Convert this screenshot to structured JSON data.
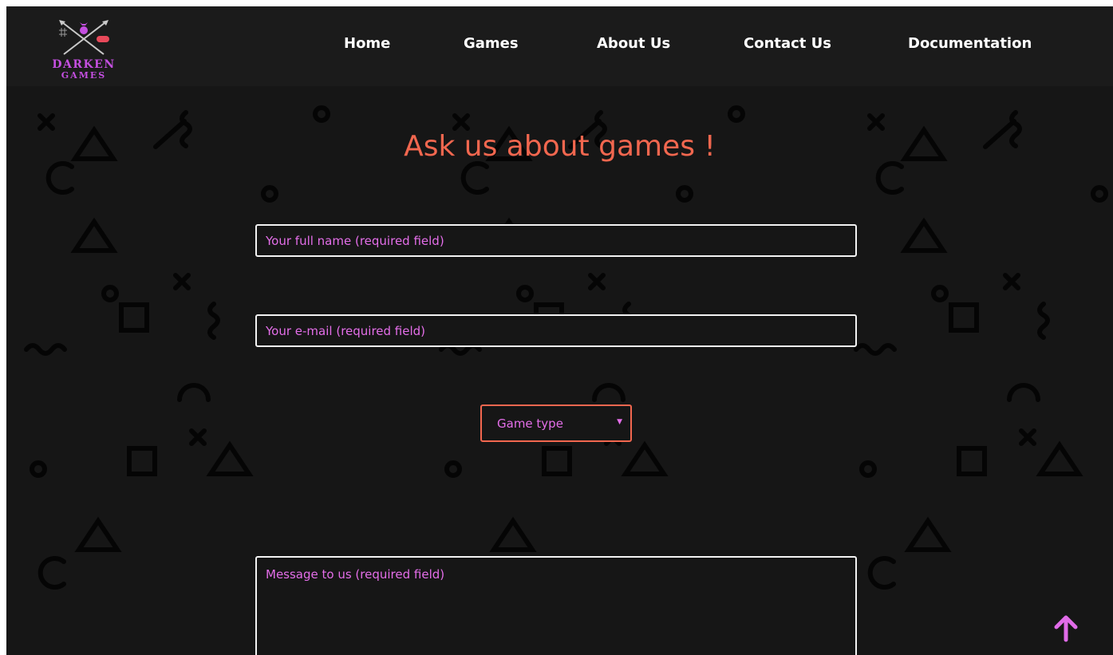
{
  "brand": {
    "name_line1": "DARKEN",
    "name_line2": "GAMES",
    "color": "#c44fe0"
  },
  "nav": {
    "items": [
      {
        "label": "Home"
      },
      {
        "label": "Games"
      },
      {
        "label": "About Us"
      },
      {
        "label": "Contact Us"
      },
      {
        "label": "Documentation"
      }
    ]
  },
  "form": {
    "title": "Ask us about games !",
    "name_placeholder": "Your full name (required field)",
    "email_placeholder": "Your e-mail (required field)",
    "game_type": {
      "selected": "Game type"
    },
    "message_placeholder": "Message to us (required field)"
  },
  "icons": {
    "logo": "crossed-arrows-gamepad-logo-icon",
    "select_caret": "triangle-down-icon",
    "scroll_top": "arrow-up-icon"
  },
  "colors": {
    "background": "#161616",
    "header": "#1b1b1b",
    "title": "#f2674f",
    "placeholder": "#e46ee9",
    "field_border": "#f3f3f3",
    "select_border": "#f2674f",
    "scroll_arrow": "#e06be8",
    "pattern": "#050505"
  }
}
